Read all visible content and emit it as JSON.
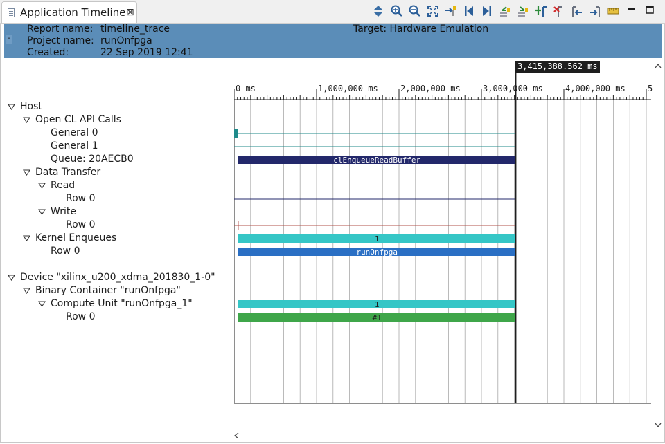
{
  "tab": {
    "title": "Application Timeline",
    "close_glyph": "⊠"
  },
  "toolbar": {
    "icons": [
      "expand-collapse-icon",
      "zoom-in-icon",
      "zoom-out-icon",
      "zoom-fit-icon",
      "jump-to-marker-icon",
      "first-event-icon",
      "last-event-icon",
      "previous-event-icon",
      "next-event-icon",
      "add-marker-icon",
      "remove-marker-icon",
      "align-left-icon",
      "align-right-icon",
      "ruler-icon"
    ]
  },
  "window_controls": {
    "minimize": "minimize-icon",
    "maximize": "maximize-icon"
  },
  "report": {
    "report_name_label": "Report name:",
    "report_name": "timeline_trace",
    "project_name_label": "Project name:",
    "project_name": "runOnfpga",
    "created_label": "Created:",
    "created": "22 Sep 2019 12:41",
    "target_label": "Target:",
    "target": "Hardware Emulation",
    "banner_color": "#5b8db8"
  },
  "tree": {
    "host": "Host",
    "opencl": "Open CL API Calls",
    "general0": "General 0",
    "general1": "General 1",
    "queue": "Queue: 20AECB0",
    "data_transfer": "Data Transfer",
    "read": "Read",
    "read_row": "Row 0",
    "write": "Write",
    "write_row": "Row 0",
    "kernel_enqueues": "Kernel Enqueues",
    "kernel_row": "Row 0",
    "device": "Device \"xilinx_u200_xdma_201830_1-0\"",
    "binary_container": "Binary Container \"runOnfpga\"",
    "compute_unit": "Compute Unit \"runOnfpga_1\"",
    "cu_row": "Row 0"
  },
  "timeline": {
    "marker_label": "3,415,388.562 ms",
    "marker_value": 3415388.562,
    "axis_max": 5000000,
    "axis_labels": [
      "0 ms",
      "1,000,000 ms",
      "2,000,000 ms",
      "3,000,000 ms",
      "4,000,000 ms",
      "5"
    ],
    "bars": {
      "queue_label": "clEnqueueReadBuffer",
      "kernel_enqueue_label": "1",
      "kernel_row_label": "runOnfpga",
      "compute_unit_label": "1",
      "cu_row_label": "#1"
    },
    "colors": {
      "queue": "#23286b",
      "kernel_enqueue": "#35c6c6",
      "kernel_row": "#2a6fc4",
      "compute_unit": "#35c6c6",
      "cu_row": "#3fa64a",
      "general0": "#1f8a8a",
      "write_line": "#b0504a",
      "read_line": "#23286b",
      "grid": "#a8a8a8"
    }
  }
}
